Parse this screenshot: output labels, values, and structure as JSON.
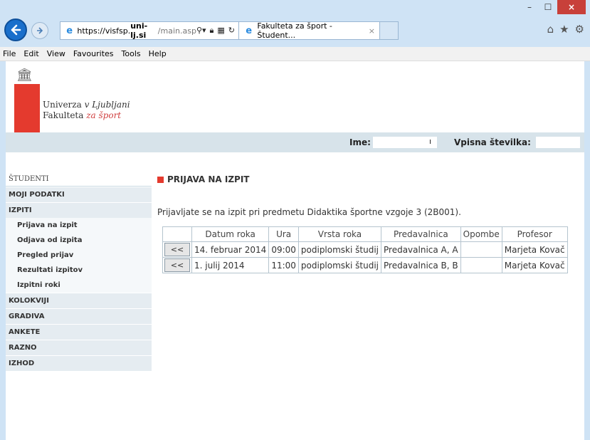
{
  "browser": {
    "url_prefix": "https://visfsp.",
    "url_domain": "uni-lj.si",
    "url_path": "/main.asp",
    "tab_title": "Fakulteta za šport - Študent...",
    "tab_close": "×",
    "window_min": "–",
    "window_max": "☐",
    "window_close": "×"
  },
  "menu": [
    "File",
    "Edit",
    "View",
    "Favourites",
    "Tools",
    "Help"
  ],
  "logo": {
    "line1_plain": "Univerza ",
    "line1_italic": "v Ljubljani",
    "line2_plain": "Fakulteta ",
    "line2_italic": "za šport"
  },
  "header": {
    "ime_label": "Ime:",
    "ime_value": "ı",
    "vpisna_label": "Vpisna številka:"
  },
  "sidebar": {
    "section": "ŠTUDENTI",
    "items": [
      "MOJI PODATKI",
      "IZPITI"
    ],
    "subitems": [
      "Prijava na izpit",
      "Odjava od izpita",
      "Pregled prijav",
      "Rezultati izpitov",
      "Izpitni roki"
    ],
    "items_after": [
      "KOLOKVIJI",
      "GRADIVA",
      "ANKETE",
      "RAZNO",
      "IZHOD"
    ]
  },
  "main": {
    "title": "PRIJAVA NA IZPIT",
    "intro": "Prijavljate se na izpit pri predmetu Didaktika športne vzgoje 3 (2B001).",
    "columns": [
      "Datum roka",
      "Ura",
      "Vrsta roka",
      "Predavalnica",
      "Opombe",
      "Profesor"
    ],
    "button_label": "<<",
    "rows": [
      [
        "14. februar 2014",
        "09:00",
        "podiplomski študij",
        "Predavalnica A, A",
        "",
        "Marjeta Kovač"
      ],
      [
        "1. julij 2014",
        "11:00",
        "podiplomski študij",
        "Predavalnica B, B",
        "",
        "Marjeta Kovač"
      ]
    ]
  }
}
